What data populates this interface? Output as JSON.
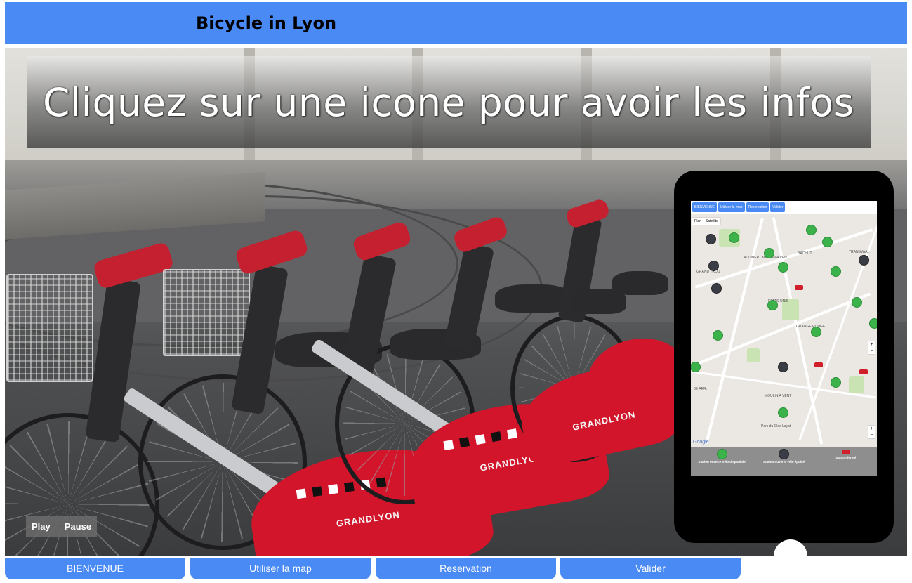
{
  "header": {
    "title": "Bicycle in Lyon"
  },
  "slideshow": {
    "caption": "Cliquez sur une icone pour avoir les infos",
    "fender_brand": "GRANDLYON",
    "controls": {
      "play_label": "Play",
      "pause_label": "Pause"
    }
  },
  "phone_mockup": {
    "tabs": [
      "BIENVENUE",
      "Utiliser la map",
      "Reservation",
      "Valider"
    ],
    "map_types": [
      "Plan",
      "Satellite"
    ],
    "map_labels": [
      "GRAND TROU",
      "AUDIBERT MOULIN A VENT",
      "BACHUT",
      "ETATS-UNIS",
      "GRANGE ROUGE",
      "MOULIN A VENT",
      "8E ARR.",
      "TRANSVAAL",
      "Parc du Clos Layat"
    ],
    "legend": [
      {
        "label": "Station ouverte Vélo disponible",
        "marker": "green"
      },
      {
        "label": "Station ouverte Vélo épuisé",
        "marker": "dark"
      },
      {
        "label": "Station fermé",
        "marker": "red"
      }
    ],
    "attribution": "Google"
  },
  "nav": {
    "items": [
      "BIENVENUE",
      "Utiliser la map",
      "Reservation",
      "Valider"
    ]
  },
  "colors": {
    "accent": "#4a8af4",
    "fender_red": "#d2152b",
    "marker_open": "#3bb24a",
    "marker_empty": "#3b3d46",
    "marker_closed": "#d01f28"
  }
}
